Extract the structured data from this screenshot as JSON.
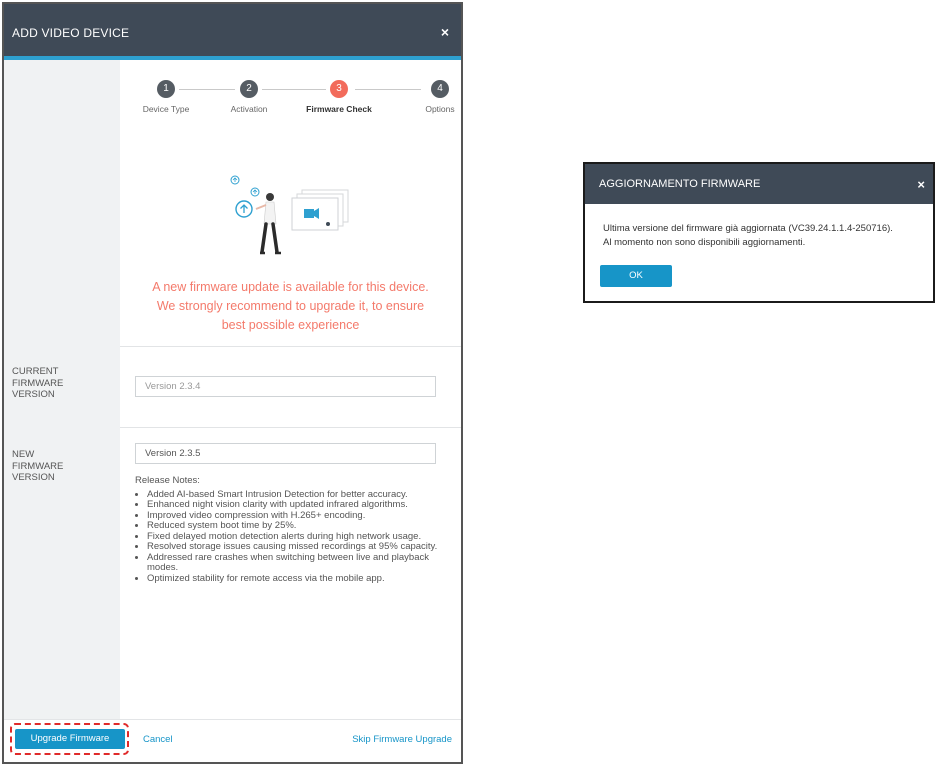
{
  "dialog": {
    "title": "ADD VIDEO DEVICE",
    "close_icon": "×",
    "steps": [
      {
        "number": "1",
        "label": "Device Type",
        "state": "done"
      },
      {
        "number": "2",
        "label": "Activation",
        "state": "done"
      },
      {
        "number": "3",
        "label": "Firmware Check",
        "state": "active"
      },
      {
        "number": "4",
        "label": "Options",
        "state": "pending"
      }
    ],
    "illustration_icon": "firmware-upload-illustration",
    "update_message": "A new firmware update is available for this device. We strongly recommend to upgrade it, to ensure best possible experience",
    "current_firmware": {
      "label_lines": [
        "CURRENT",
        "FIRMWARE",
        "VERSION"
      ],
      "value": "Version 2.3.4"
    },
    "new_firmware": {
      "label_lines": [
        "NEW",
        "FIRMWARE",
        "VERSION"
      ],
      "value": "Version 2.3.5"
    },
    "release_notes": {
      "title": "Release Notes:",
      "items": [
        "Added AI-based Smart Intrusion Detection for better accuracy.",
        "Enhanced night vision clarity with updated infrared algorithms.",
        "Improved video compression with H.265+ encoding.",
        "Reduced system boot time by 25%.",
        "Fixed delayed motion detection alerts during high network usage.",
        "Resolved storage issues causing missed recordings at 95% capacity.",
        "Addressed rare crashes when switching between live and playback modes.",
        "Optimized stability for remote access via the mobile app."
      ]
    },
    "footer": {
      "upgrade_label": "Upgrade Firmware",
      "cancel_label": "Cancel",
      "skip_label": "Skip Firmware Upgrade"
    }
  },
  "popup": {
    "title": "AGGIORNAMENTO FIRMWARE",
    "close_icon": "×",
    "message_lines": [
      "Ultima versione del firmware già aggiornata (VC39.24.1.1.4-250716).",
      "Al momento non sono disponibili aggiornamenti."
    ],
    "ok_label": "OK"
  },
  "colors": {
    "header": "#3f4a57",
    "accent": "#1795c8",
    "active_step": "#f26b5b",
    "warning_text": "#f47a6b",
    "highlight_border": "#e02a2a"
  }
}
